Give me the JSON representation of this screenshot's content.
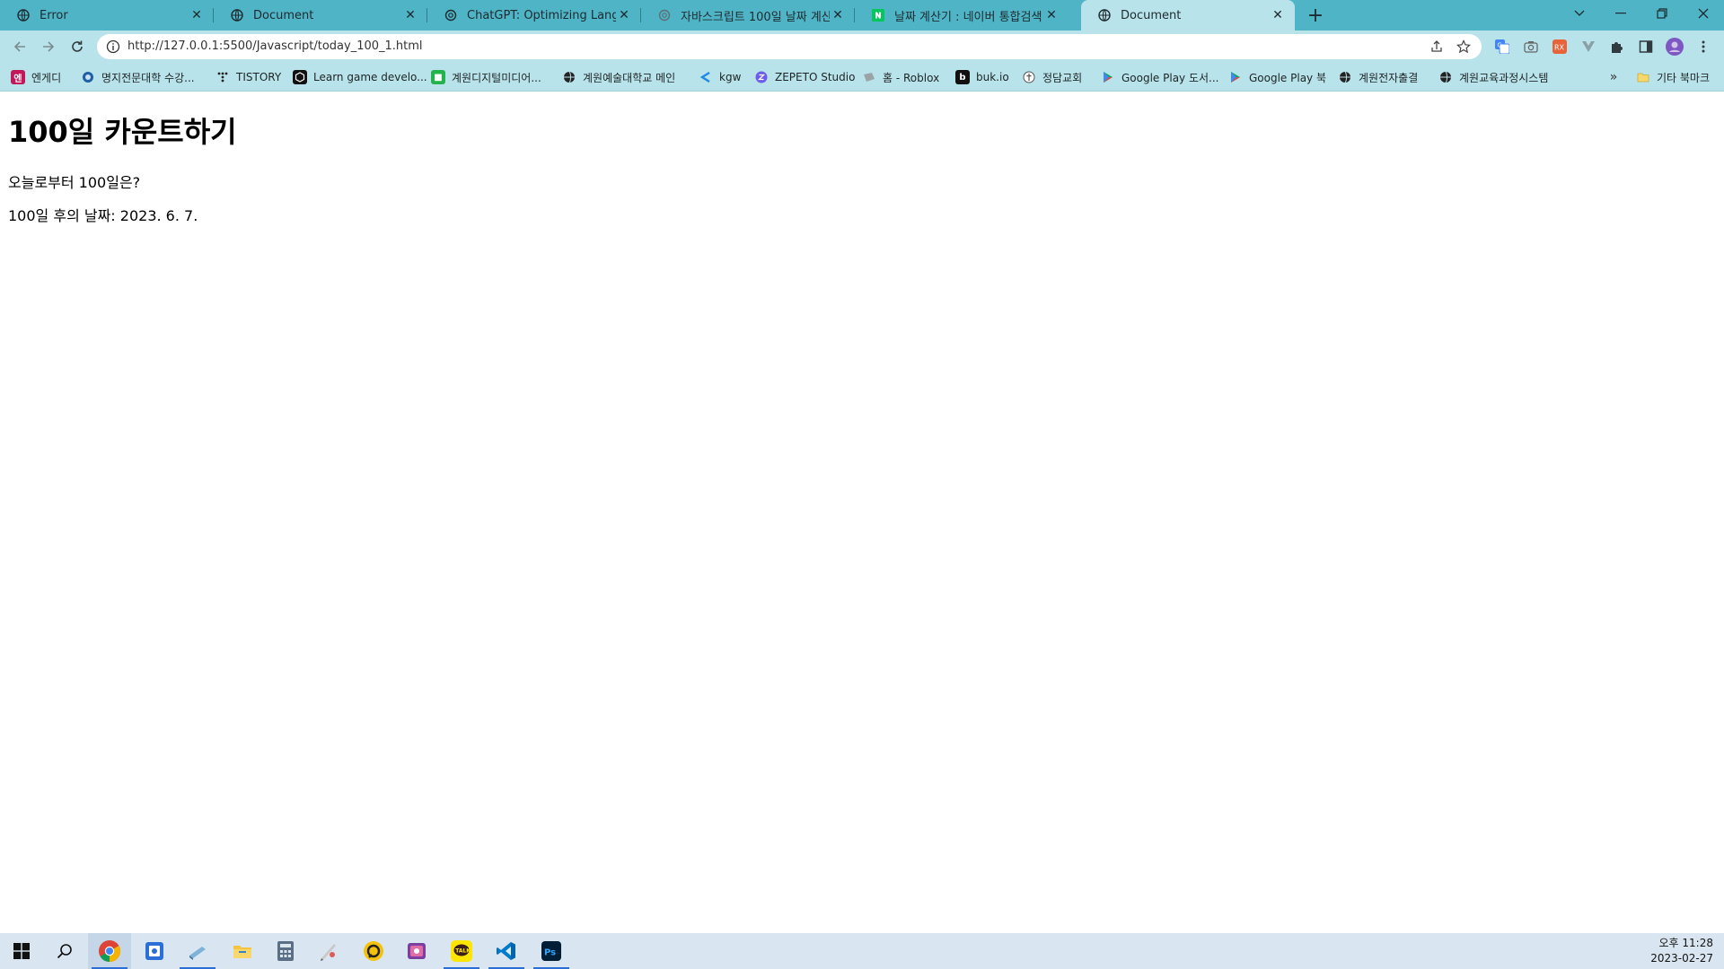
{
  "browser": {
    "tabs": [
      {
        "title": "Error",
        "icon": "globe-icon",
        "active": false
      },
      {
        "title": "Document",
        "icon": "globe-icon",
        "active": false
      },
      {
        "title": "ChatGPT: Optimizing Language",
        "icon": "chatgpt-icon",
        "active": false
      },
      {
        "title": "자바스크립트 100일 날짜 계산",
        "icon": "chatgpt-icon",
        "active": false
      },
      {
        "title": "날짜 계산기 : 네이버 통합검색",
        "icon": "naver-icon",
        "active": false
      },
      {
        "title": "Document",
        "icon": "globe-icon",
        "active": true
      }
    ],
    "url": "http://127.0.0.1:5500/Javascript/today_100_1.html",
    "bookmarks": [
      {
        "label": "엔게디",
        "icon": "engedi-icon",
        "color": "#c2185b"
      },
      {
        "label": "명지전문대학 수강...",
        "icon": "mjc-icon",
        "color": "#1f5fa8"
      },
      {
        "label": "TISTORY",
        "icon": "tistory-icon",
        "color": "#222222"
      },
      {
        "label": "Learn game develo...",
        "icon": "unity-icon",
        "color": "#111111"
      },
      {
        "label": "계원디지털미디어...",
        "icon": "kaywon-digital-icon",
        "color": "#23b24b"
      },
      {
        "label": "계원예술대학교 메인",
        "icon": "globe-icon",
        "color": "#222222"
      },
      {
        "label": "kgw",
        "icon": "kgw-icon",
        "color": "#1e88e5"
      },
      {
        "label": "ZEPETO Studio",
        "icon": "zepeto-icon",
        "color": "#6c5ce7"
      },
      {
        "label": "홈 - Roblox",
        "icon": "roblox-icon",
        "color": "#888888"
      },
      {
        "label": "buk.io",
        "icon": "bukio-icon",
        "color": "#111111"
      },
      {
        "label": "정담교회",
        "icon": "church-icon",
        "color": "#555555"
      },
      {
        "label": "Google Play 도서...",
        "icon": "google-play-icon",
        "color": "#00a862"
      },
      {
        "label": "Google Play 북",
        "icon": "google-play-icon",
        "color": "#00a862"
      },
      {
        "label": "계원전자출결",
        "icon": "globe-icon",
        "color": "#222222"
      },
      {
        "label": "계원교육과정시스템",
        "icon": "globe-icon",
        "color": "#222222"
      }
    ],
    "other_bookmarks": "기타 북마크",
    "colors": {
      "tabstrip": "#4fb4c6",
      "toolbar": "#b9e3ea"
    }
  },
  "page": {
    "title": "100일 카운트하기",
    "question": "오늘로부터 100일은?",
    "result": "100일 후의 날짜: 2023. 6. 7."
  },
  "taskbar": {
    "apps": [
      "windows-start-icon",
      "search-icon",
      "chrome-icon",
      "app-icon",
      "app-icon",
      "file-explorer-icon",
      "calculator-icon",
      "app-icon",
      "app-icon",
      "app-icon",
      "kakaotalk-icon",
      "vscode-icon",
      "photoshop-icon"
    ],
    "time": "오후 11:28",
    "date": "2023-02-27"
  }
}
